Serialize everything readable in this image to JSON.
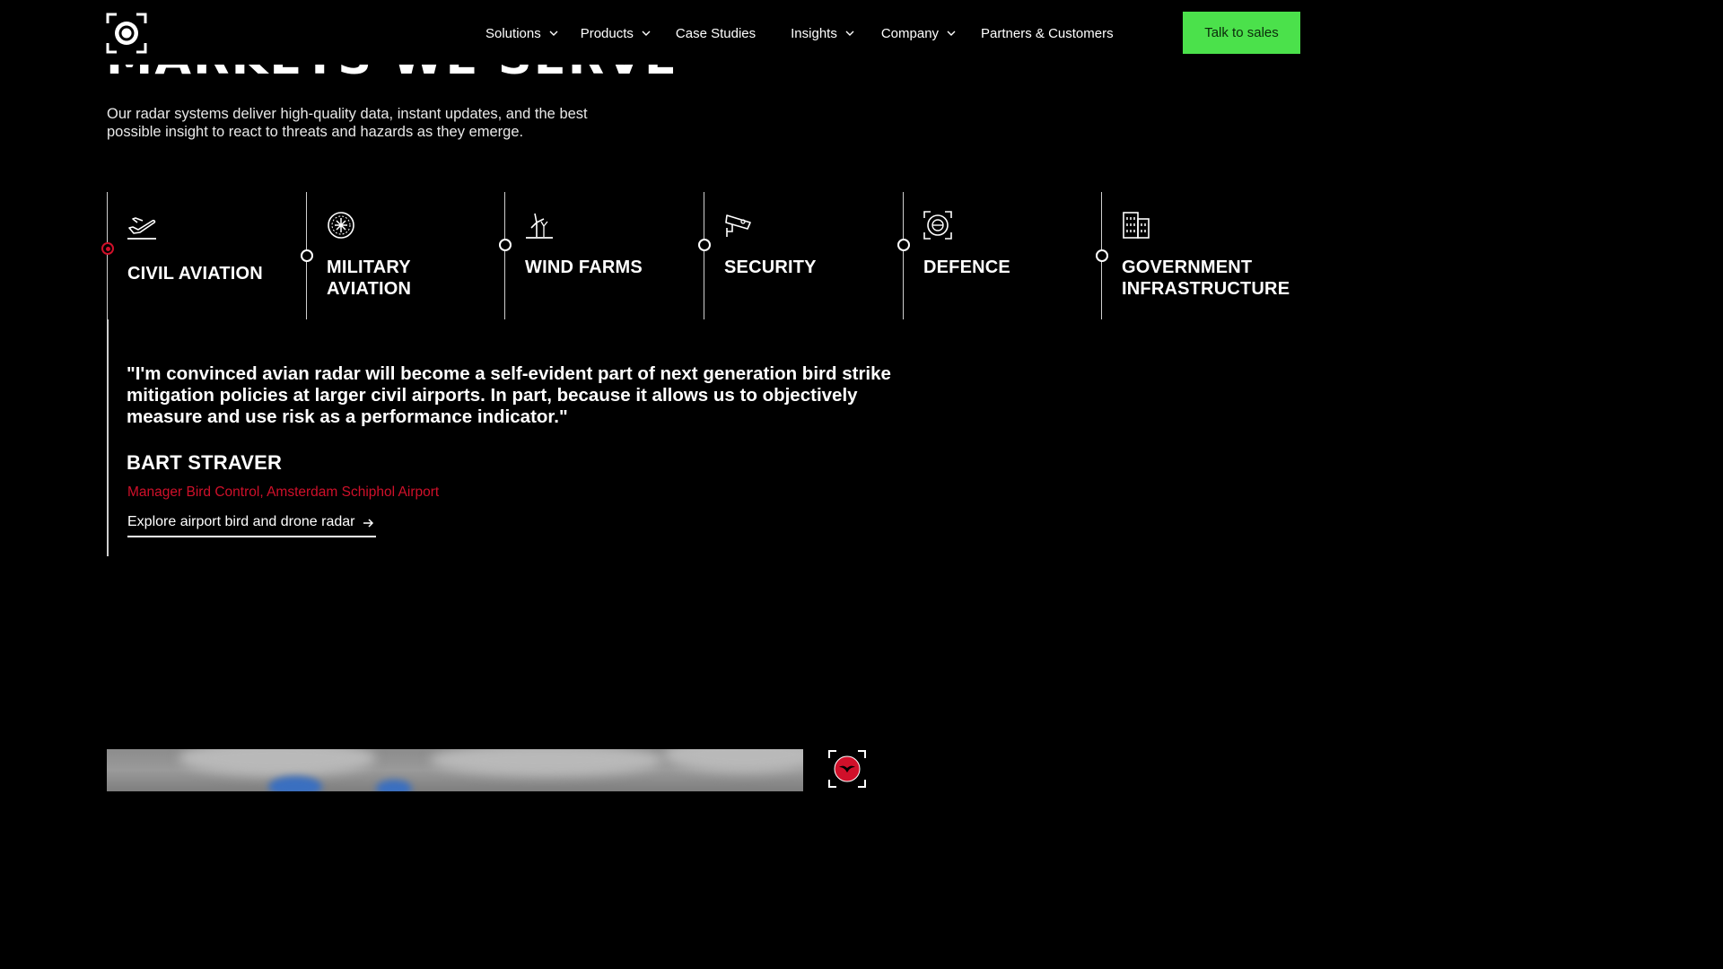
{
  "header": {
    "nav": [
      {
        "label": "Solutions",
        "has_dropdown": true
      },
      {
        "label": "Products",
        "has_dropdown": true
      },
      {
        "label": "Case Studies",
        "has_dropdown": false
      },
      {
        "label": "Insights",
        "has_dropdown": true
      },
      {
        "label": "Company",
        "has_dropdown": true
      },
      {
        "label": "Partners & Customers",
        "has_dropdown": false
      }
    ],
    "cta_label": "Talk to sales"
  },
  "section": {
    "title": "MARKETS WE SERVE",
    "intro": "Our radar systems deliver high-quality data, instant updates, and the best possible insight to react to threats and hazards as they emerge."
  },
  "markets": [
    {
      "label": "CIVIL AVIATION",
      "icon": "airplane-icon",
      "active": true
    },
    {
      "label": "MILITARY\nAVIATION",
      "icon": "military-aviation-icon",
      "active": false
    },
    {
      "label": "WIND FARMS",
      "icon": "wind-turbine-icon",
      "active": false
    },
    {
      "label": "SECURITY",
      "icon": "security-camera-icon",
      "active": false
    },
    {
      "label": "DEFENCE",
      "icon": "radar-target-icon",
      "active": false
    },
    {
      "label": "GOVERNMENT\nINFRASTRUCTURE",
      "icon": "building-icon",
      "active": false
    }
  ],
  "testimonial": {
    "quote": "\"I'm convinced avian radar will become a self-evident part of next generation bird strike mitigation policies at larger civil airports. In part, because it allows us to objectively measure and use risk as a performance indicator.\"",
    "name": "BART STRAVER",
    "role": "Manager Bird Control, Amsterdam Schiphol Airport",
    "link_label": "Explore airport bird and drone radar"
  },
  "colors": {
    "background": "#000000",
    "accent_green": "#4be14b",
    "accent_red": "#d0102a"
  }
}
